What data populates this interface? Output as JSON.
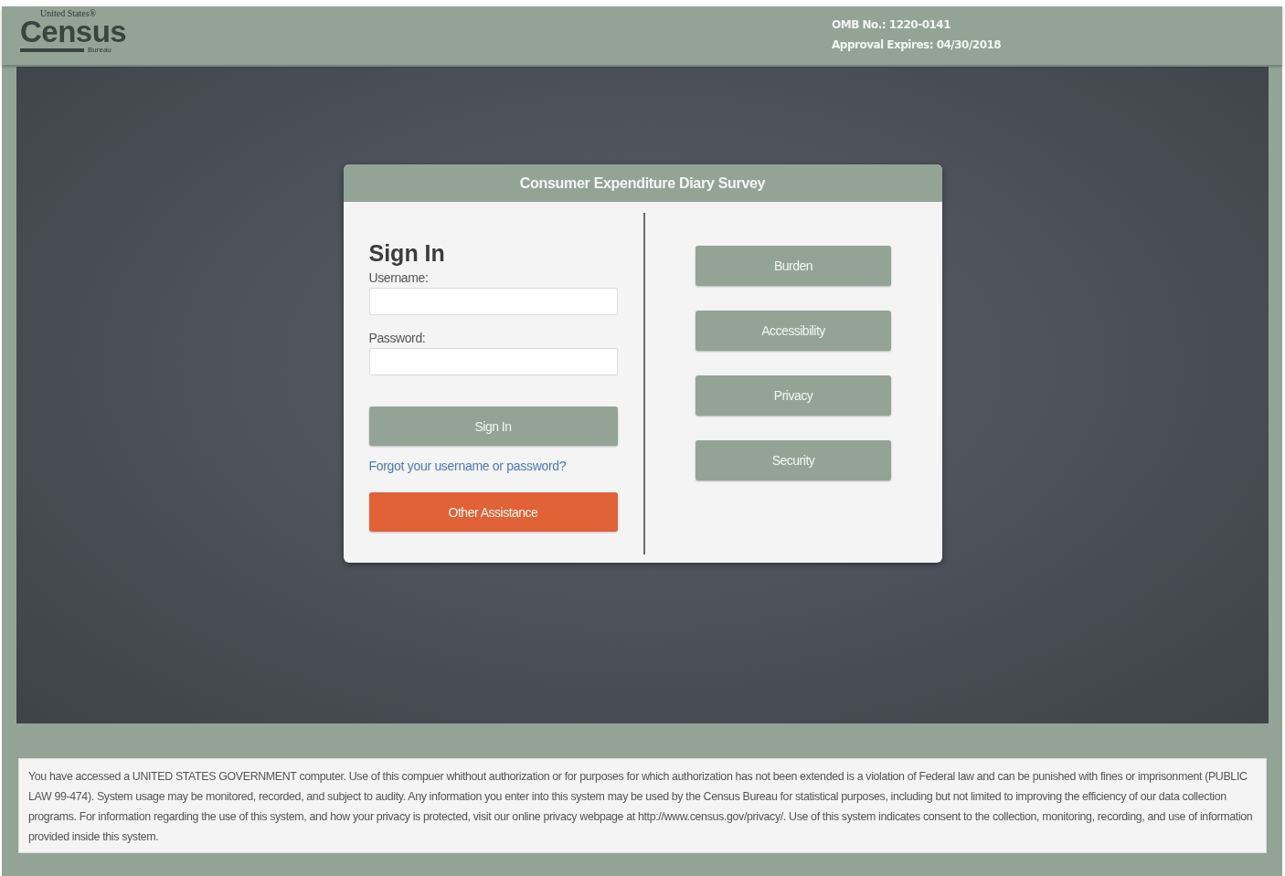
{
  "header": {
    "logo": {
      "top": "United States®",
      "main": "Census",
      "bottom": "Bureau"
    },
    "omb_number": "OMB No.: 1220-0141",
    "approval_expires": "Approval Expires: 04/30/2018"
  },
  "login_card": {
    "title": "Consumer Expenditure Diary Survey",
    "heading": "Sign In",
    "fields": [
      {
        "label": "Username:"
      },
      {
        "label": "Password:"
      }
    ],
    "sign_in_button": "Sign In",
    "forgot_link": "Forgot your username or password?",
    "assistance_button": "Other Assistance",
    "info_buttons": [
      "Burden",
      "Accessibility",
      "Privacy",
      "Security"
    ]
  },
  "notice": "You have accessed a UNITED STATES GOVERNMENT computer. Use of this compuer whithout authorization or for purposes for which authorization has not been extended is a violation of Federal law and can be punished with fines or imprisonment (PUBLIC LAW 99-474). System usage may be monitored, recorded, and subject to audity. Any information you enter into this system may be used by the Census Bureau for statistical purposes, including but not limited to improving the efficiency of our data collection programs. For information regarding the use of this system, and how your privacy is protected, visit our online privacy webpage at http://www.census.gov/privacy/. Use of this system indicates consent to the collection, monitoring, recording, and use of information provided inside this system."
}
